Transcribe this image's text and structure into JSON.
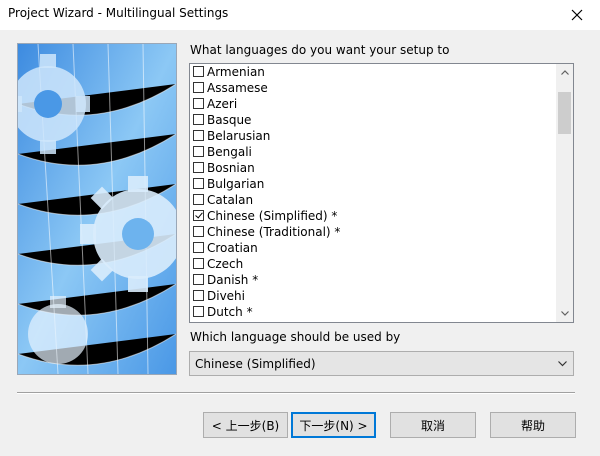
{
  "window": {
    "title": "Project Wizard - Multilingual Settings"
  },
  "languages": {
    "question": "What languages do you want your setup to",
    "items": [
      {
        "label": "Armenian",
        "checked": false
      },
      {
        "label": "Assamese",
        "checked": false
      },
      {
        "label": "Azeri",
        "checked": false
      },
      {
        "label": "Basque",
        "checked": false
      },
      {
        "label": "Belarusian",
        "checked": false
      },
      {
        "label": "Bengali",
        "checked": false
      },
      {
        "label": "Bosnian",
        "checked": false
      },
      {
        "label": "Bulgarian",
        "checked": false
      },
      {
        "label": "Catalan",
        "checked": false
      },
      {
        "label": "Chinese (Simplified) *",
        "checked": true
      },
      {
        "label": "Chinese (Traditional) *",
        "checked": false
      },
      {
        "label": "Croatian",
        "checked": false
      },
      {
        "label": "Czech",
        "checked": false
      },
      {
        "label": "Danish *",
        "checked": false
      },
      {
        "label": "Divehi",
        "checked": false
      },
      {
        "label": "Dutch *",
        "checked": false
      }
    ]
  },
  "default_language": {
    "question": "Which language should be used by",
    "selected": "Chinese (Simplified)"
  },
  "buttons": {
    "prev": "< 上一步(B)",
    "next": "下一步(N) >",
    "cancel": "取消",
    "help": "帮助"
  }
}
